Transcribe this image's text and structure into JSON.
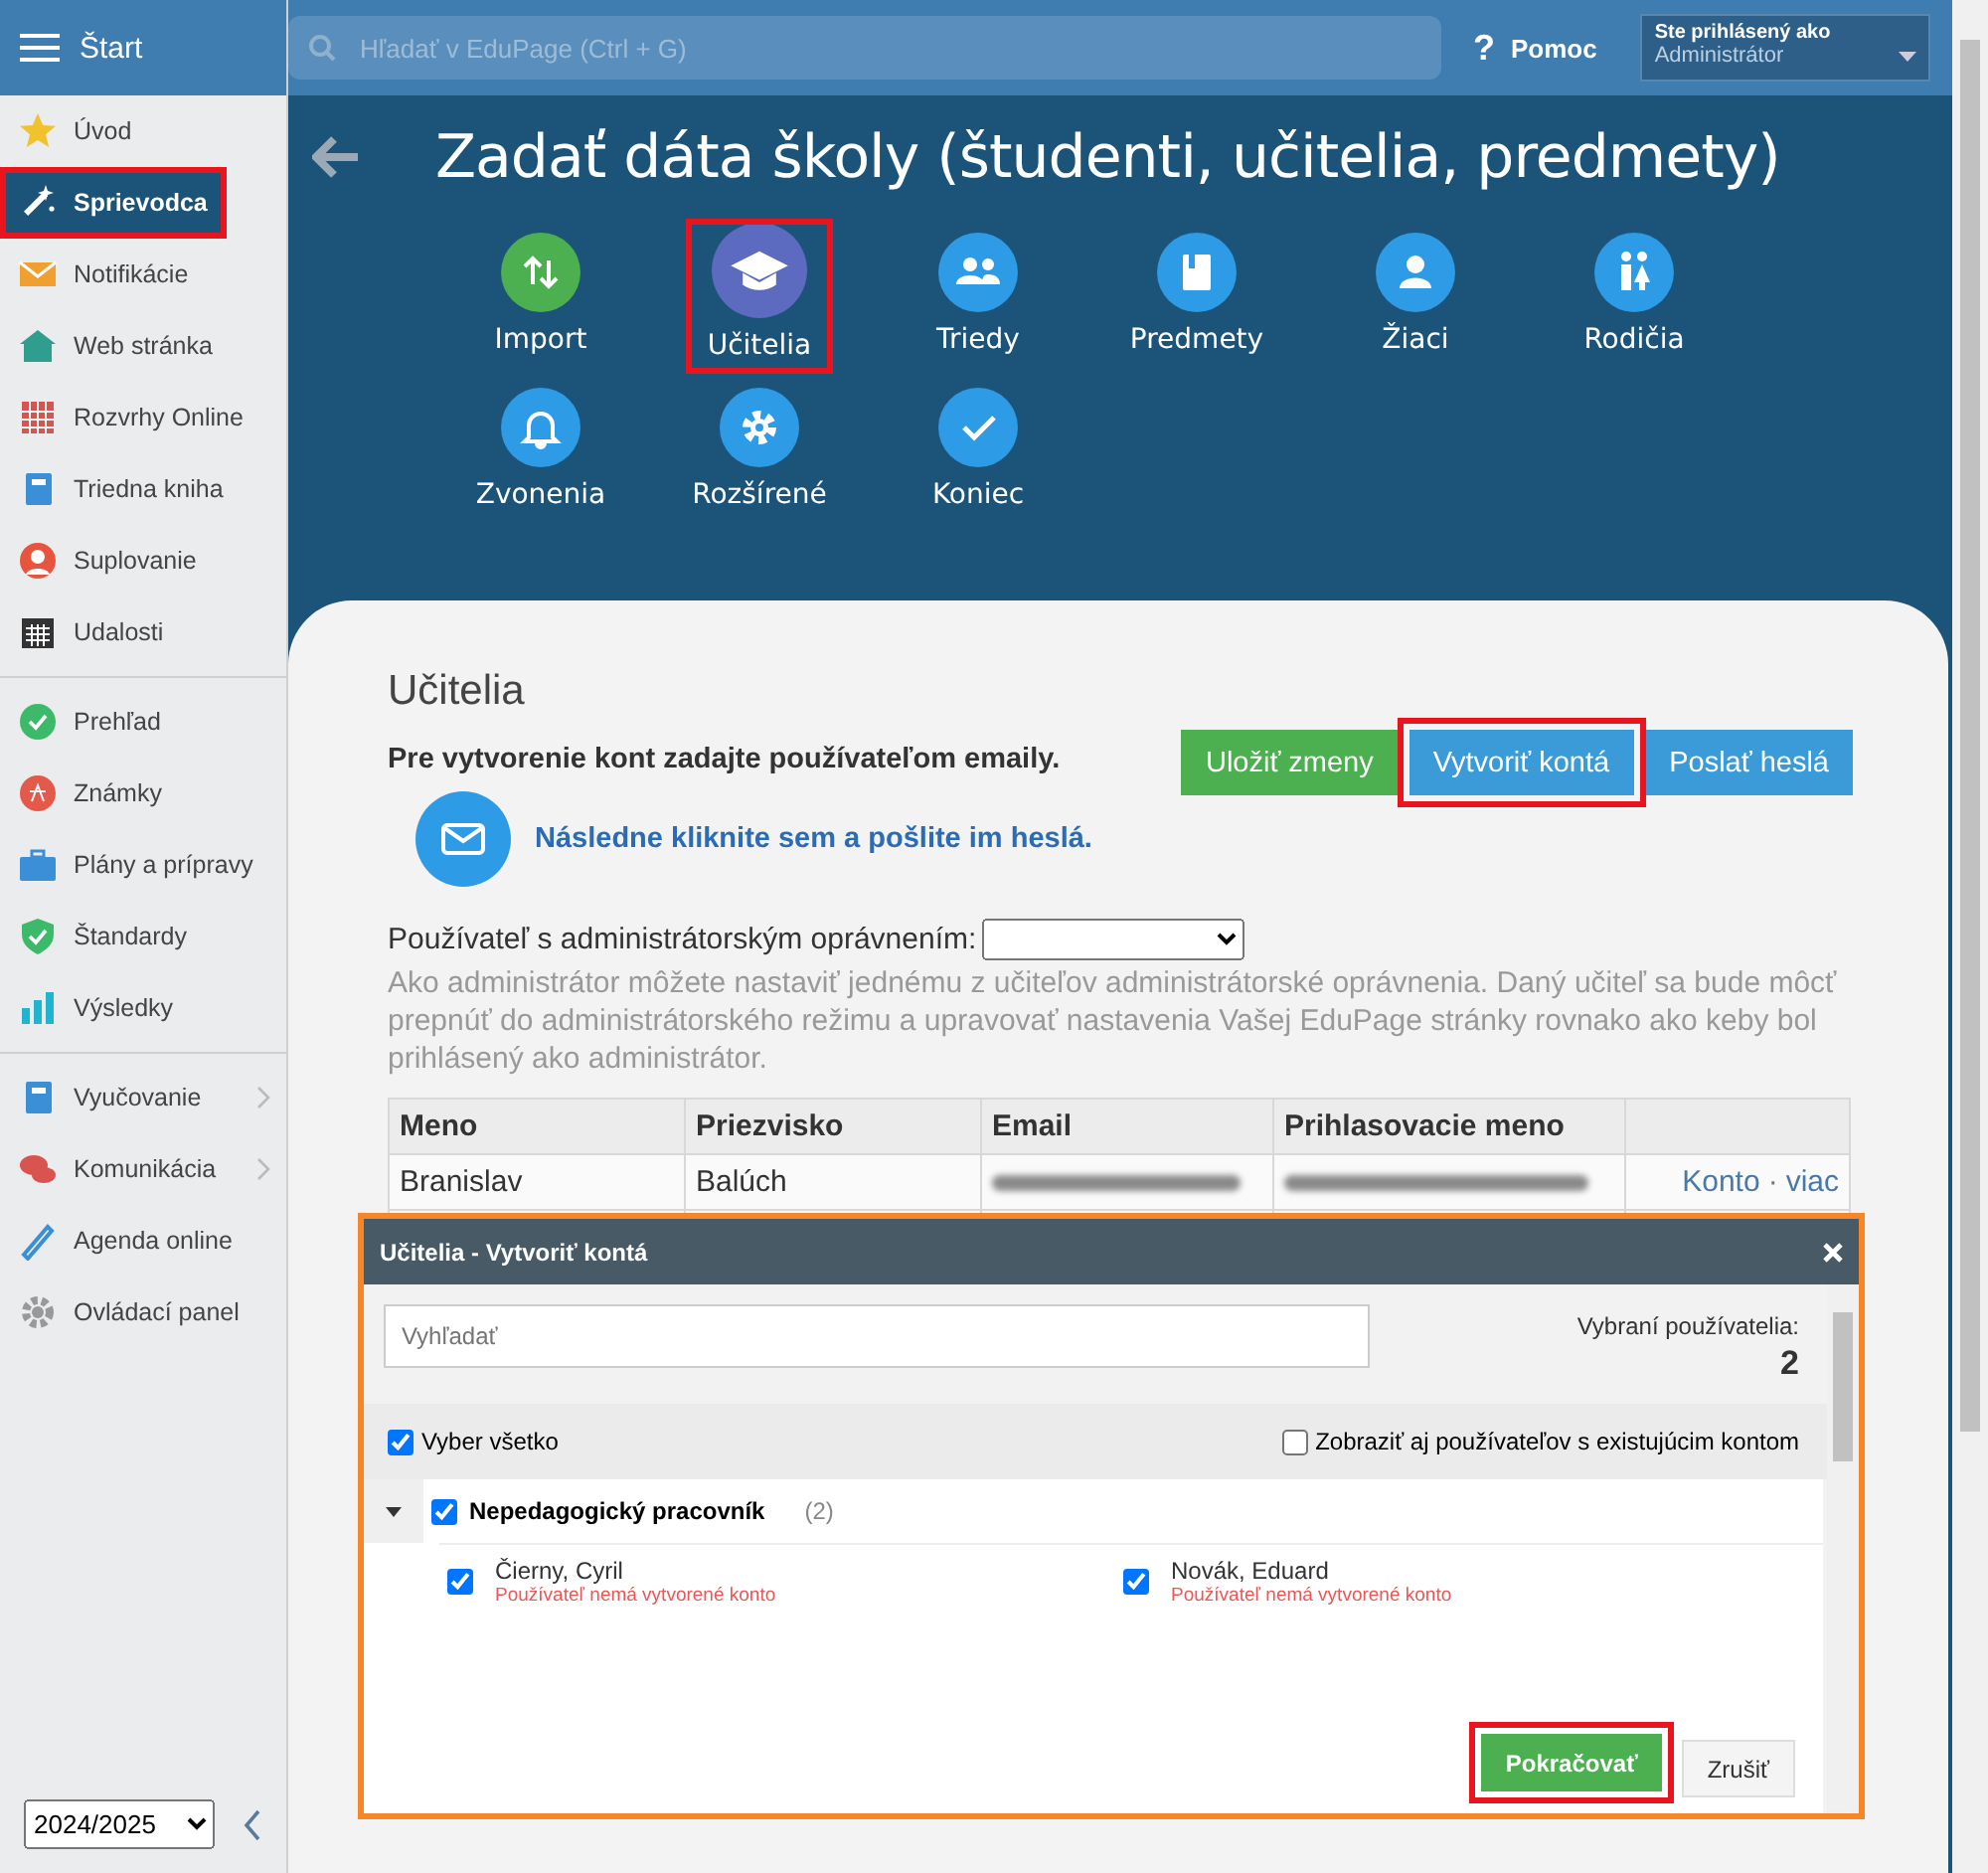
{
  "sidebar": {
    "title": "Štart",
    "groups": [
      [
        {
          "label": "Úvod",
          "selected": false,
          "highlighted": false,
          "has_submenu": false
        },
        {
          "label": "Sprievodca",
          "selected": true,
          "highlighted": true,
          "has_submenu": false
        },
        {
          "label": "Notifikácie",
          "selected": false,
          "highlighted": false,
          "has_submenu": false
        },
        {
          "label": "Web stránka",
          "selected": false,
          "highlighted": false,
          "has_submenu": false
        },
        {
          "label": "Rozvrhy Online",
          "selected": false,
          "highlighted": false,
          "has_submenu": false
        },
        {
          "label": "Triedna kniha",
          "selected": false,
          "highlighted": false,
          "has_submenu": false
        },
        {
          "label": "Suplovanie",
          "selected": false,
          "highlighted": false,
          "has_submenu": false
        },
        {
          "label": "Udalosti",
          "selected": false,
          "highlighted": false,
          "has_submenu": false
        }
      ],
      [
        {
          "label": "Prehľad",
          "selected": false,
          "highlighted": false,
          "has_submenu": false
        },
        {
          "label": "Známky",
          "selected": false,
          "highlighted": false,
          "has_submenu": false
        },
        {
          "label": "Plány a prípravy",
          "selected": false,
          "highlighted": false,
          "has_submenu": false
        },
        {
          "label": "Štandardy",
          "selected": false,
          "highlighted": false,
          "has_submenu": false
        },
        {
          "label": "Výsledky",
          "selected": false,
          "highlighted": false,
          "has_submenu": false
        }
      ],
      [
        {
          "label": "Vyučovanie",
          "selected": false,
          "highlighted": false,
          "has_submenu": true
        },
        {
          "label": "Komunikácia",
          "selected": false,
          "highlighted": false,
          "has_submenu": true
        },
        {
          "label": "Agenda online",
          "selected": false,
          "highlighted": false,
          "has_submenu": false
        },
        {
          "label": "Ovládací panel",
          "selected": false,
          "highlighted": false,
          "has_submenu": false
        }
      ]
    ],
    "school_year": "2024/2025"
  },
  "topbar": {
    "search_placeholder": "Hľadať v EduPage (Ctrl + G)",
    "help_icon": "?",
    "help": "Pomoc",
    "user_caption": "Ste prihlásený ako",
    "user_role": "Administrátor"
  },
  "page_title": "Zadať dáta školy (študenti, učitelia, predmety)",
  "steps": [
    {
      "label": "Import",
      "selected": false,
      "highlighted": false,
      "color": "#4caf50"
    },
    {
      "label": "Učitelia",
      "selected": true,
      "highlighted": true,
      "color": "#5c6bc0"
    },
    {
      "label": "Triedy",
      "selected": false,
      "highlighted": false,
      "color": "#2e9be6"
    },
    {
      "label": "Predmety",
      "selected": false,
      "highlighted": false,
      "color": "#2e9be6"
    },
    {
      "label": "Žiaci",
      "selected": false,
      "highlighted": false,
      "color": "#2e9be6"
    },
    {
      "label": "Rodičia",
      "selected": false,
      "highlighted": false,
      "color": "#2e9be6"
    },
    {
      "label": "Zvonenia",
      "selected": false,
      "highlighted": false,
      "color": "#2e9be6"
    },
    {
      "label": "Rozšírené",
      "selected": false,
      "highlighted": false,
      "color": "#2e9be6"
    },
    {
      "label": "Koniec",
      "selected": false,
      "highlighted": false,
      "color": "#2e9be6"
    }
  ],
  "section": {
    "title": "Učitelia",
    "instruction": "Pre vytvorenie kont zadajte používateľom emaily.",
    "mail_link": "Následne kliknite sem a pošlite im heslá.",
    "buttons": [
      {
        "label": "Uložiť zmeny",
        "kind": "success",
        "highlighted": false
      },
      {
        "label": "Vytvoriť kontá",
        "kind": "primary",
        "highlighted": true
      },
      {
        "label": "Poslať heslá",
        "kind": "primary",
        "highlighted": false
      }
    ],
    "admin_label": "Používateľ s administrátorským oprávnením:",
    "admin_help": "Ako administrátor môžete nastaviť jednému z učiteľov administrátorské oprávnenia. Daný učiteľ sa bude môcť prepnúť do administrátorského režimu a upravovať nastavenia Vašej EduPage stránky rovnako ako keby bol prihlásený ako administrátor.",
    "table": {
      "columns": [
        "Meno",
        "Priezvisko",
        "Email",
        "Prihlasovacie meno"
      ],
      "rows": [
        {
          "first_name": "Branislav",
          "last_name": "Balúch",
          "links": [
            "Konto",
            "viac"
          ],
          "link_separator": "·"
        }
      ]
    }
  },
  "dialog": {
    "title": "Učitelia - Vytvoriť kontá",
    "search_placeholder": "Vyhľadať",
    "selected_caption": "Vybraní používatelia:",
    "selected_count": "2",
    "select_all": {
      "label": "Vyber všetko",
      "checked": true
    },
    "show_existing": {
      "label": "Zobraziť aj používateľov s existujúcim kontom",
      "checked": false
    },
    "groups": [
      {
        "name": "Nepedagogický pracovník",
        "count": "(2)",
        "checked": true,
        "expanded": true,
        "users": [
          {
            "name": "Čierny, Cyril",
            "note": "Používateľ nemá vytvorené konto",
            "checked": true
          },
          {
            "name": "Novák, Eduard",
            "note": "Používateľ nemá vytvorené konto",
            "checked": true
          }
        ]
      }
    ],
    "continue_button": {
      "label": "Pokračovať",
      "highlighted": true
    },
    "cancel_button": "Zrušiť"
  }
}
